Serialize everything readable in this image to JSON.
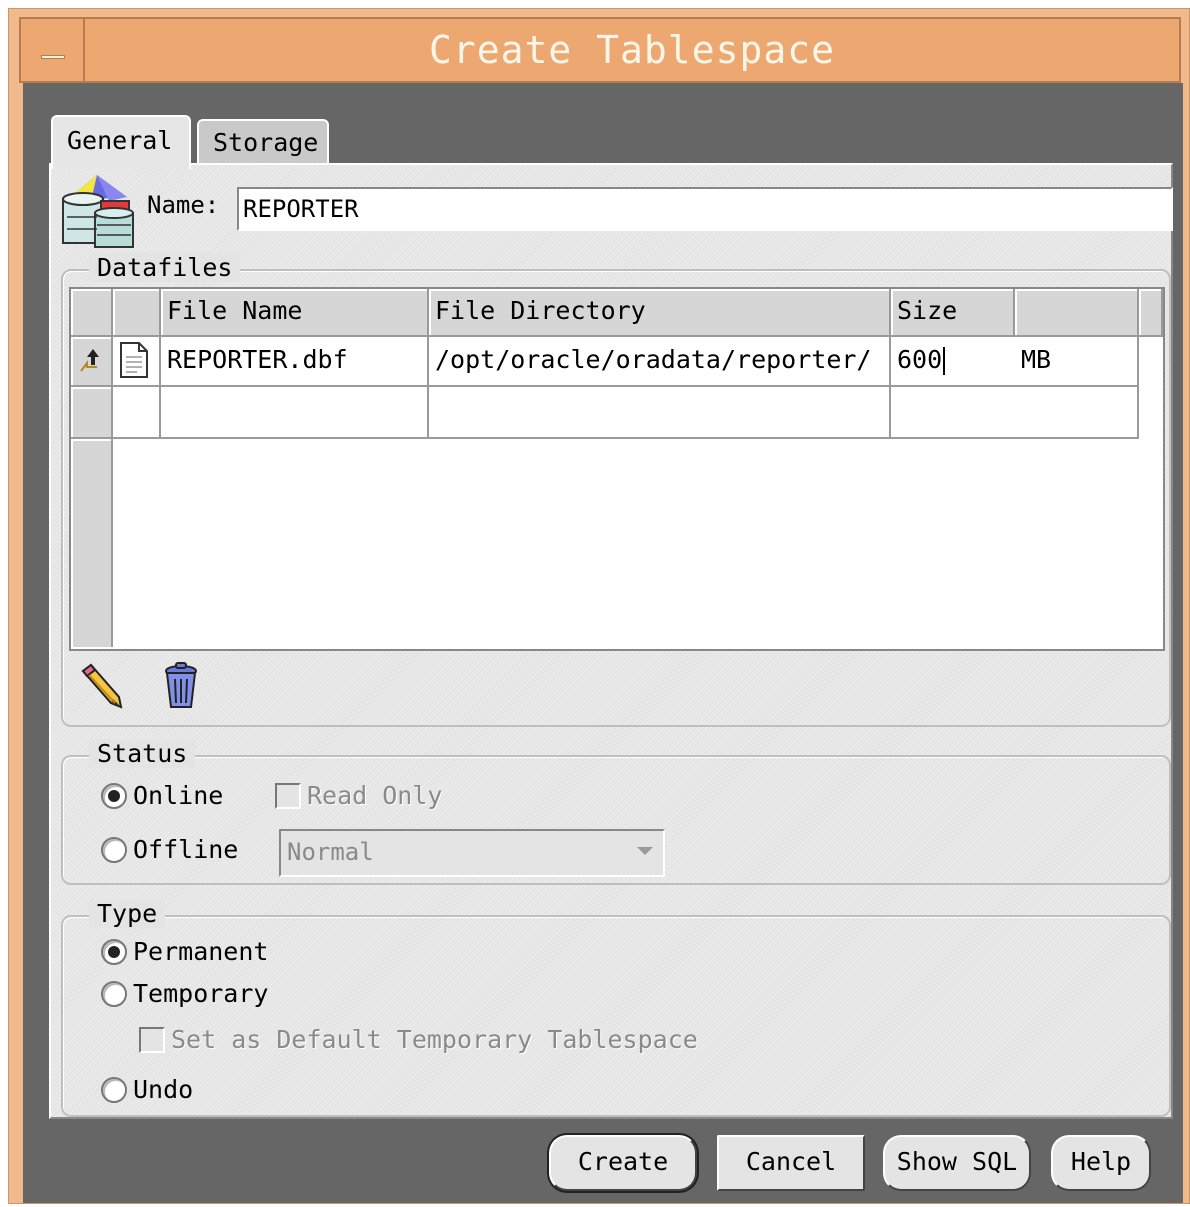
{
  "window": {
    "title": "Create Tablespace"
  },
  "tabs": [
    {
      "label": "General"
    },
    {
      "label": "Storage"
    }
  ],
  "general": {
    "name_label": "Name:",
    "name_value": "REPORTER"
  },
  "datafiles": {
    "legend": "Datafiles",
    "columns": [
      "File Name",
      "File Directory",
      "Size",
      ""
    ],
    "rows": [
      {
        "file_name": "REPORTER.dbf",
        "directory": "/opt/oracle/oradata/reporter/",
        "size": "600",
        "unit": "MB"
      },
      {
        "file_name": "",
        "directory": "",
        "size": "",
        "unit": ""
      }
    ]
  },
  "status": {
    "legend": "Status",
    "online_label": "Online",
    "offline_label": "Offline",
    "readonly_label": "Read Only",
    "offline_mode_value": "Normal",
    "selected": "Online"
  },
  "type": {
    "legend": "Type",
    "permanent_label": "Permanent",
    "temporary_label": "Temporary",
    "default_temp_label": "Set as Default Temporary Tablespace",
    "undo_label": "Undo",
    "selected": "Permanent"
  },
  "buttons": {
    "create": "Create",
    "cancel": "Cancel",
    "show_sql": "Show SQL",
    "help": "Help"
  },
  "icons": {
    "window_menu": "window-menu-icon",
    "tablespace": "tablespace-icon",
    "edit": "pencil-icon",
    "delete": "trash-icon",
    "row_current": "current-row-arrow-icon",
    "datafile": "datafile-icon"
  },
  "colors": {
    "titlebar": "#eda872",
    "client": "#666666",
    "panel": "#e4e4e4"
  }
}
